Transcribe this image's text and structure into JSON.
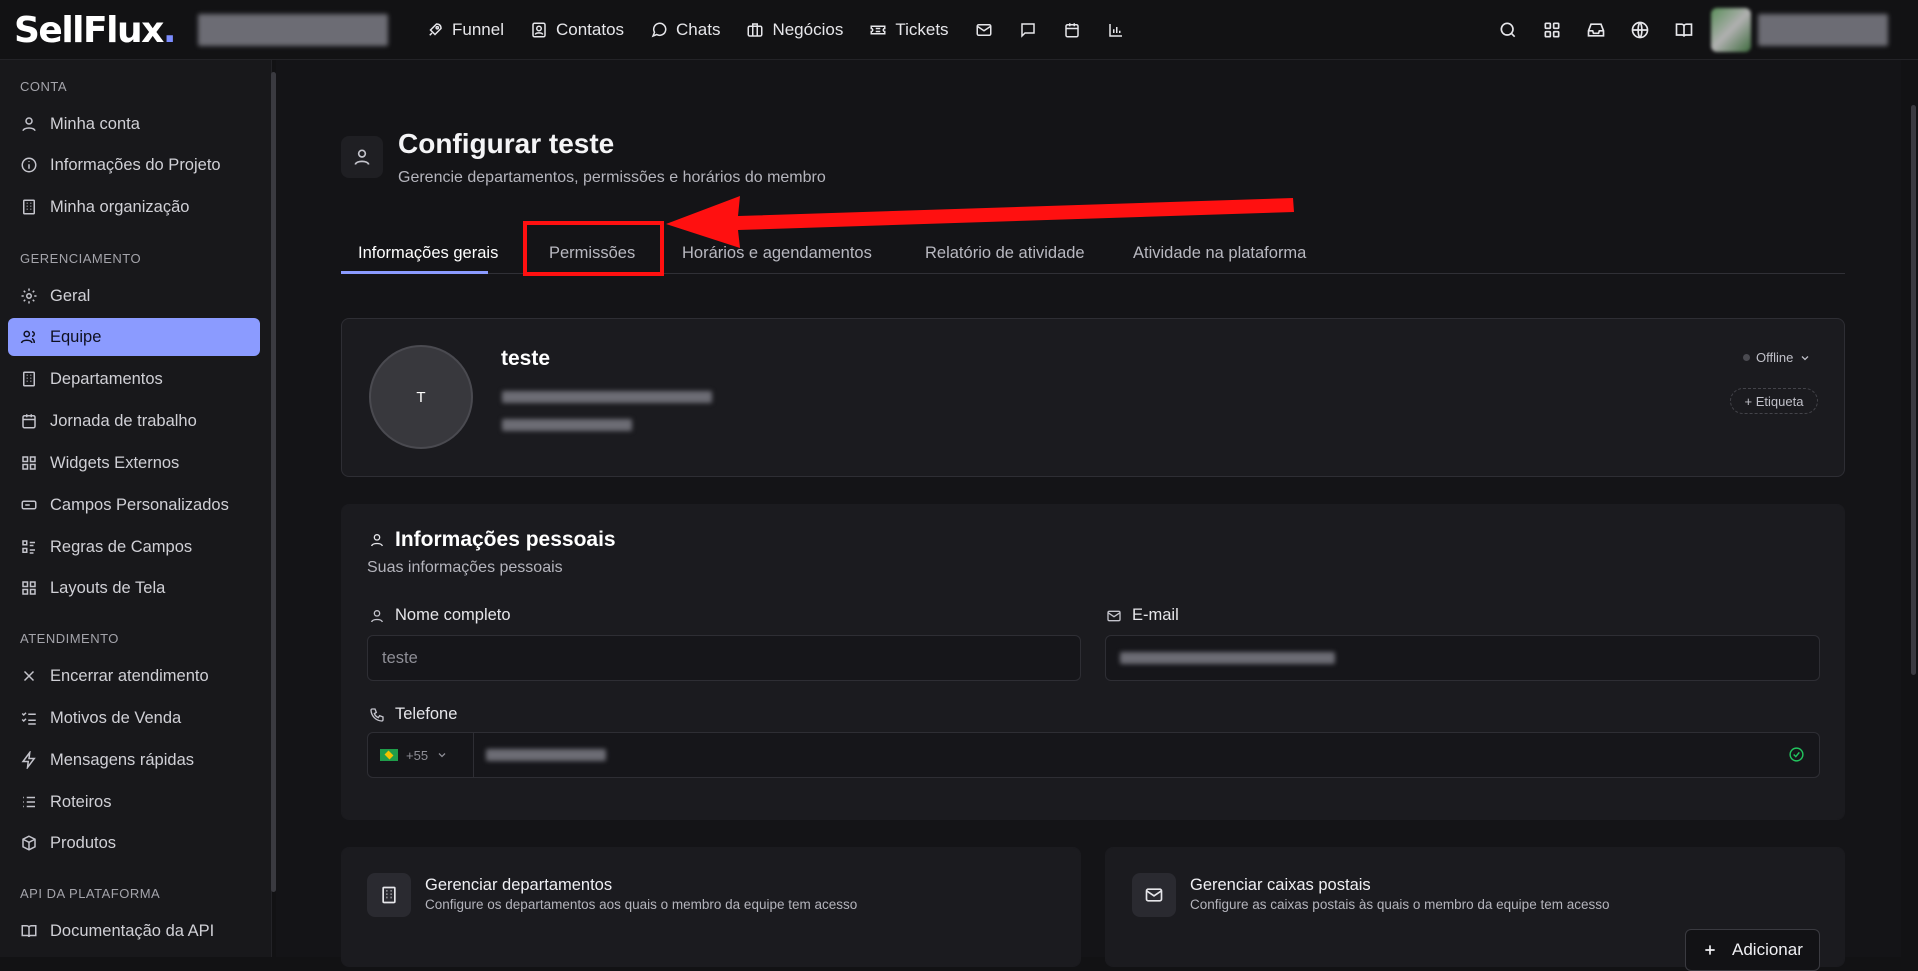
{
  "app": {
    "logo_text": "SellFlux",
    "logo_dot": "."
  },
  "topnav": {
    "items": [
      {
        "label": "Funnel",
        "icon": "rocket-icon"
      },
      {
        "label": "Contatos",
        "icon": "contact-card-icon"
      },
      {
        "label": "Chats",
        "icon": "chat-bubble-icon"
      },
      {
        "label": "Negócios",
        "icon": "briefcase-icon"
      },
      {
        "label": "Tickets",
        "icon": "ticket-icon"
      }
    ],
    "icon_only": [
      "mail-icon",
      "message-square-icon",
      "calendar-icon",
      "bar-chart-icon"
    ],
    "right_icons": [
      "search-icon",
      "apps-grid-icon",
      "inbox-icon",
      "globe-icon",
      "book-open-icon",
      "headset-icon"
    ]
  },
  "sidebar": {
    "sections": [
      {
        "title": "CONTA",
        "items": [
          {
            "label": "Minha conta",
            "icon": "user-icon"
          },
          {
            "label": "Informações do Projeto",
            "icon": "info-icon"
          },
          {
            "label": "Minha organização",
            "icon": "building-icon"
          }
        ]
      },
      {
        "title": "GERENCIAMENTO",
        "items": [
          {
            "label": "Geral",
            "icon": "gear-icon"
          },
          {
            "label": "Equipe",
            "icon": "users-icon",
            "active": true
          },
          {
            "label": "Departamentos",
            "icon": "building-icon"
          },
          {
            "label": "Jornada de trabalho",
            "icon": "calendar-icon"
          },
          {
            "label": "Widgets Externos",
            "icon": "widgets-icon"
          },
          {
            "label": "Campos Personalizados",
            "icon": "input-field-icon"
          },
          {
            "label": "Regras de Campos",
            "icon": "list-rules-icon"
          },
          {
            "label": "Layouts de Tela",
            "icon": "layout-icon"
          }
        ]
      },
      {
        "title": "ATENDIMENTO",
        "items": [
          {
            "label": "Encerrar atendimento",
            "icon": "close-icon"
          },
          {
            "label": "Motivos de Venda",
            "icon": "checklist-icon"
          },
          {
            "label": "Mensagens rápidas",
            "icon": "lightning-icon"
          },
          {
            "label": "Roteiros",
            "icon": "list-icon"
          },
          {
            "label": "Produtos",
            "icon": "box-icon"
          }
        ]
      },
      {
        "title": "API DA PLATAFORMA",
        "items": [
          {
            "label": "Documentação da API",
            "icon": "book-icon"
          }
        ]
      }
    ]
  },
  "page": {
    "title": "Configurar teste",
    "subtitle": "Gerencie departamentos, permissões e horários do membro",
    "tabs": [
      {
        "label": "Informações gerais",
        "active": true
      },
      {
        "label": "Permissões"
      },
      {
        "label": "Horários e agendamentos"
      },
      {
        "label": "Relatório de atividade"
      },
      {
        "label": "Atividade na plataforma"
      }
    ]
  },
  "member": {
    "initial": "T",
    "name": "teste",
    "status": "Offline",
    "tag_button": "+ Etiqueta"
  },
  "personal": {
    "title": "Informações pessoais",
    "subtitle": "Suas informações pessoais",
    "name_label": "Nome completo",
    "name_value": "teste",
    "email_label": "E-mail",
    "phone_label": "Telefone",
    "phone_code": "+55"
  },
  "departments": {
    "title": "Gerenciar departamentos",
    "subtitle": "Configure os departamentos aos quais o membro da equipe tem acesso"
  },
  "mailboxes": {
    "title": "Gerenciar caixas postais",
    "subtitle": "Configure as caixas postais às quais o membro da equipe tem acesso",
    "add_label": "Adicionar"
  },
  "colors": {
    "accent": "#8b9bff",
    "annotation": "#ff1010",
    "success": "#22c55e"
  }
}
